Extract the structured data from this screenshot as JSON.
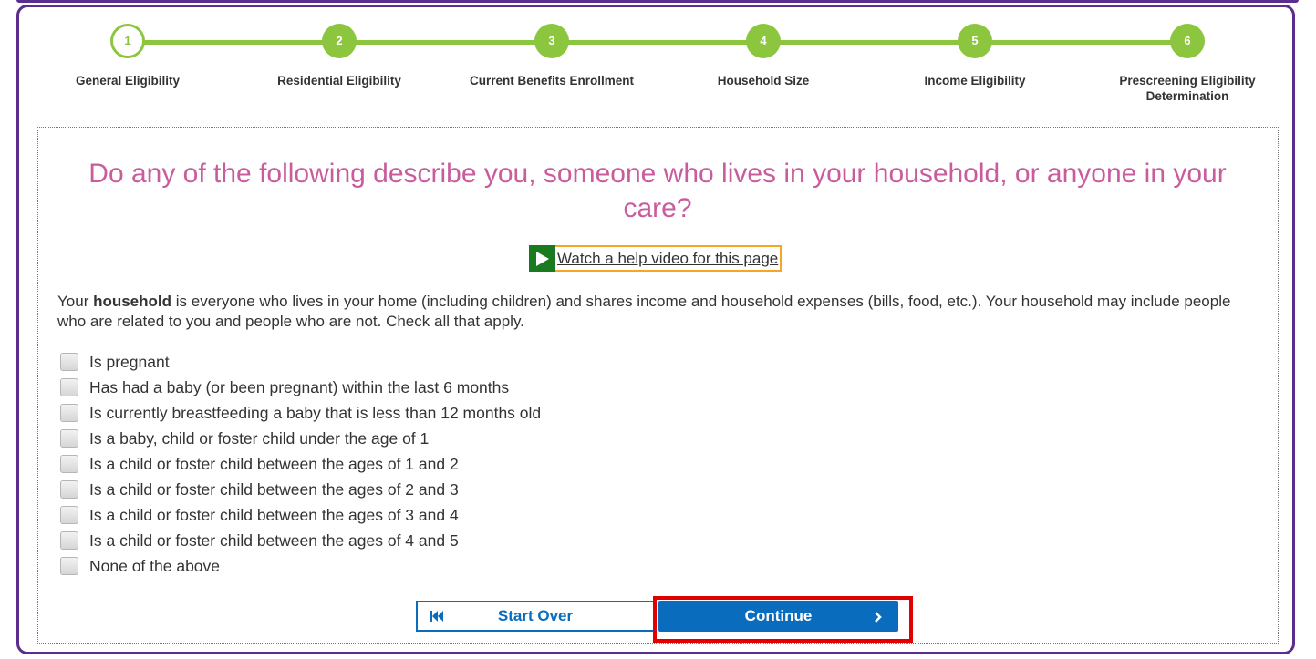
{
  "stepper": {
    "steps": [
      {
        "number": "1",
        "label": "General Eligibility",
        "status": "current"
      },
      {
        "number": "2",
        "label": "Residential Eligibility",
        "status": "upcoming"
      },
      {
        "number": "3",
        "label": "Current Benefits Enrollment",
        "status": "upcoming"
      },
      {
        "number": "4",
        "label": "Household Size",
        "status": "upcoming"
      },
      {
        "number": "5",
        "label": "Income Eligibility",
        "status": "upcoming"
      },
      {
        "number": "6",
        "label": "Prescreening Eligibility Determination",
        "status": "upcoming"
      }
    ]
  },
  "question": {
    "title": "Do any of the following describe you, someone who lives in your household, or anyone in your care?"
  },
  "help": {
    "link_text": "Watch a help video for this page"
  },
  "intro": {
    "prefix": "Your ",
    "bold_term": "household",
    "body": " is everyone who lives in your home (including children) and shares income and household expenses (bills, food, etc.). Your household may include people who are related to you and people who are not. Check all that apply."
  },
  "options": [
    {
      "label": "Is pregnant",
      "checked": false
    },
    {
      "label": "Has had a baby (or been pregnant) within the last 6 months",
      "checked": false
    },
    {
      "label": "Is currently breastfeeding a baby that is less than 12 months old",
      "checked": false
    },
    {
      "label": "Is a baby, child or foster child under the age of 1",
      "checked": false
    },
    {
      "label": "Is a child or foster child between the ages of 1 and 2",
      "checked": false
    },
    {
      "label": "Is a child or foster child between the ages of 2 and 3",
      "checked": false
    },
    {
      "label": "Is a child or foster child between the ages of 3 and 4",
      "checked": false
    },
    {
      "label": "Is a child or foster child between the ages of 4 and 5",
      "checked": false
    },
    {
      "label": "None of the above",
      "checked": false
    }
  ],
  "actions": {
    "start_over_label": "Start Over",
    "continue_label": "Continue"
  },
  "colors": {
    "brand_purple": "#5b2d8e",
    "step_green": "#8cc63f",
    "question_pink": "#c95c9d",
    "primary_blue": "#0a6cbd",
    "highlight_red": "#e00000",
    "help_border_orange": "#f5a623",
    "play_green": "#1a7a1f"
  },
  "icons": {
    "play": "play-icon",
    "start_over": "skip-back-icon",
    "continue": "chevron-right-icon"
  }
}
